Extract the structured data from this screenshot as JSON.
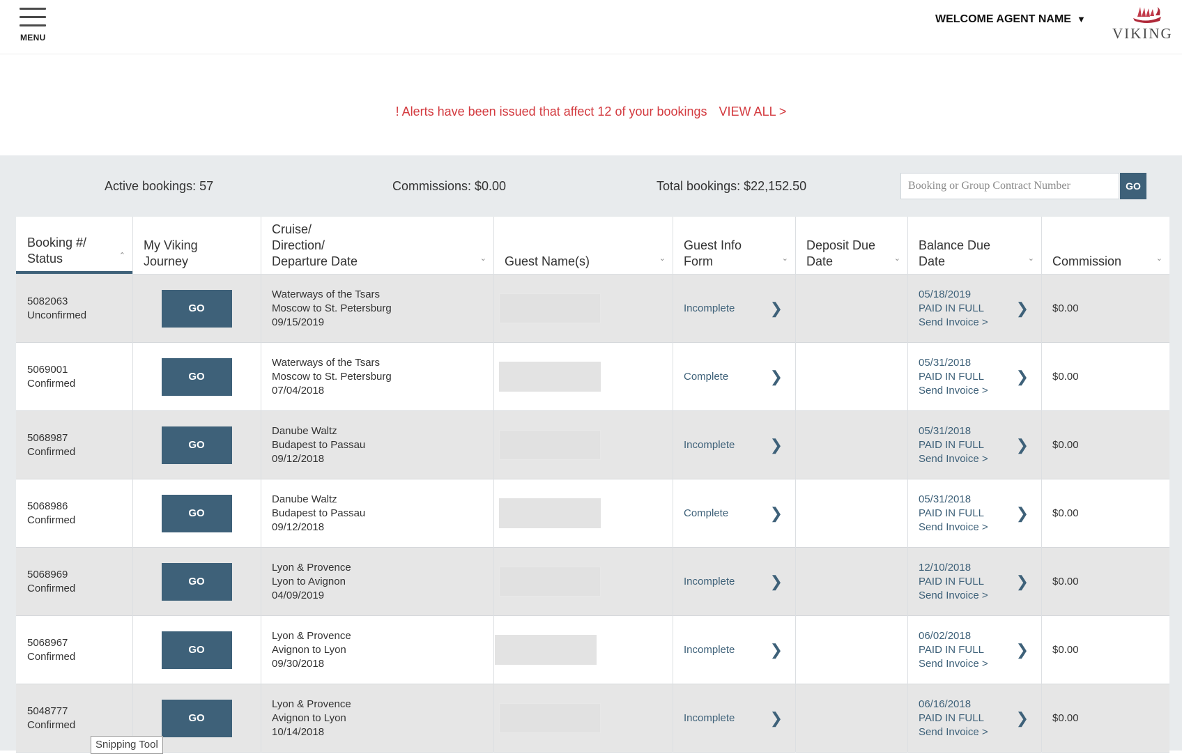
{
  "header": {
    "menu_label": "MENU",
    "welcome": "WELCOME AGENT NAME",
    "logo_text": "VIKING"
  },
  "alert": {
    "message": "! Alerts have been issued that affect 12 of your bookings",
    "view_all": "VIEW ALL >"
  },
  "stats": {
    "active": "Active bookings: 57",
    "commissions": "Commissions: $0.00",
    "total": "Total bookings: $22,152.50"
  },
  "search": {
    "placeholder": "Booking or Group Contract Number",
    "go": "GO"
  },
  "columns": [
    {
      "label_lines": [
        "Booking #/",
        "Status"
      ]
    },
    {
      "label_lines": [
        "My Viking",
        "Journey"
      ]
    },
    {
      "label_lines": [
        "Cruise/",
        "Direction/",
        "Departure Date"
      ]
    },
    {
      "label_lines": [
        "Guest Name(s)"
      ]
    },
    {
      "label_lines": [
        "Guest Info",
        "Form"
      ]
    },
    {
      "label_lines": [
        "Deposit Due",
        "Date"
      ]
    },
    {
      "label_lines": [
        "Balance Due",
        "Date"
      ]
    },
    {
      "label_lines": [
        "Commission"
      ]
    }
  ],
  "rows": [
    {
      "booking": "5082063",
      "status": "Unconfirmed",
      "go": "GO",
      "cruise": "Waterways of the Tsars",
      "direction": "Moscow to St. Petersburg",
      "departure": "09/15/2019",
      "form": "Incomplete",
      "balance_date": "05/18/2019",
      "balance_status": "PAID IN FULL",
      "send_invoice": "Send Invoice >",
      "commission": "$0.00"
    },
    {
      "booking": "5069001",
      "status": "Confirmed",
      "go": "GO",
      "cruise": "Waterways of the Tsars",
      "direction": "Moscow to St. Petersburg",
      "departure": "07/04/2018",
      "form": "Complete",
      "balance_date": "05/31/2018",
      "balance_status": "PAID IN FULL",
      "send_invoice": "Send Invoice >",
      "commission": "$0.00"
    },
    {
      "booking": "5068987",
      "status": "Confirmed",
      "go": "GO",
      "cruise": "Danube Waltz",
      "direction": "Budapest to Passau",
      "departure": "09/12/2018",
      "form": "Incomplete",
      "balance_date": "05/31/2018",
      "balance_status": "PAID IN FULL",
      "send_invoice": "Send Invoice >",
      "commission": "$0.00"
    },
    {
      "booking": "5068986",
      "status": "Confirmed",
      "go": "GO",
      "cruise": "Danube Waltz",
      "direction": "Budapest to Passau",
      "departure": "09/12/2018",
      "form": "Complete",
      "balance_date": "05/31/2018",
      "balance_status": "PAID IN FULL",
      "send_invoice": "Send Invoice >",
      "commission": "$0.00"
    },
    {
      "booking": "5068969",
      "status": "Confirmed",
      "go": "GO",
      "cruise": "Lyon & Provence",
      "direction": "Lyon to Avignon",
      "departure": "04/09/2019",
      "form": "Incomplete",
      "balance_date": "12/10/2018",
      "balance_status": "PAID IN FULL",
      "send_invoice": "Send Invoice >",
      "commission": "$0.00"
    },
    {
      "booking": "5068967",
      "status": "Confirmed",
      "go": "GO",
      "cruise": "Lyon & Provence",
      "direction": "Avignon to Lyon",
      "departure": "09/30/2018",
      "form": "Incomplete",
      "balance_date": "06/02/2018",
      "balance_status": "PAID IN FULL",
      "send_invoice": "Send Invoice >",
      "commission": "$0.00"
    },
    {
      "booking": "5048777",
      "status": "Confirmed",
      "go": "GO",
      "cruise": "Lyon & Provence",
      "direction": "Avignon to Lyon",
      "departure": "10/14/2018",
      "form": "Incomplete",
      "balance_date": "06/16/2018",
      "balance_status": "PAID IN FULL",
      "send_invoice": "Send Invoice >",
      "commission": "$0.00"
    }
  ],
  "tooltip": "Snipping Tool",
  "colors": {
    "accent": "#3e6179",
    "alert": "#d33a3f",
    "panel": "#e8ebed",
    "row_alt": "#e6e6e6"
  },
  "icons": {
    "menu": "hamburger-icon",
    "logo": "viking-ship-icon",
    "dropdown": "caret-down-icon",
    "row_action": "chevron-right-icon",
    "sort": "sort-chevron-icon"
  }
}
